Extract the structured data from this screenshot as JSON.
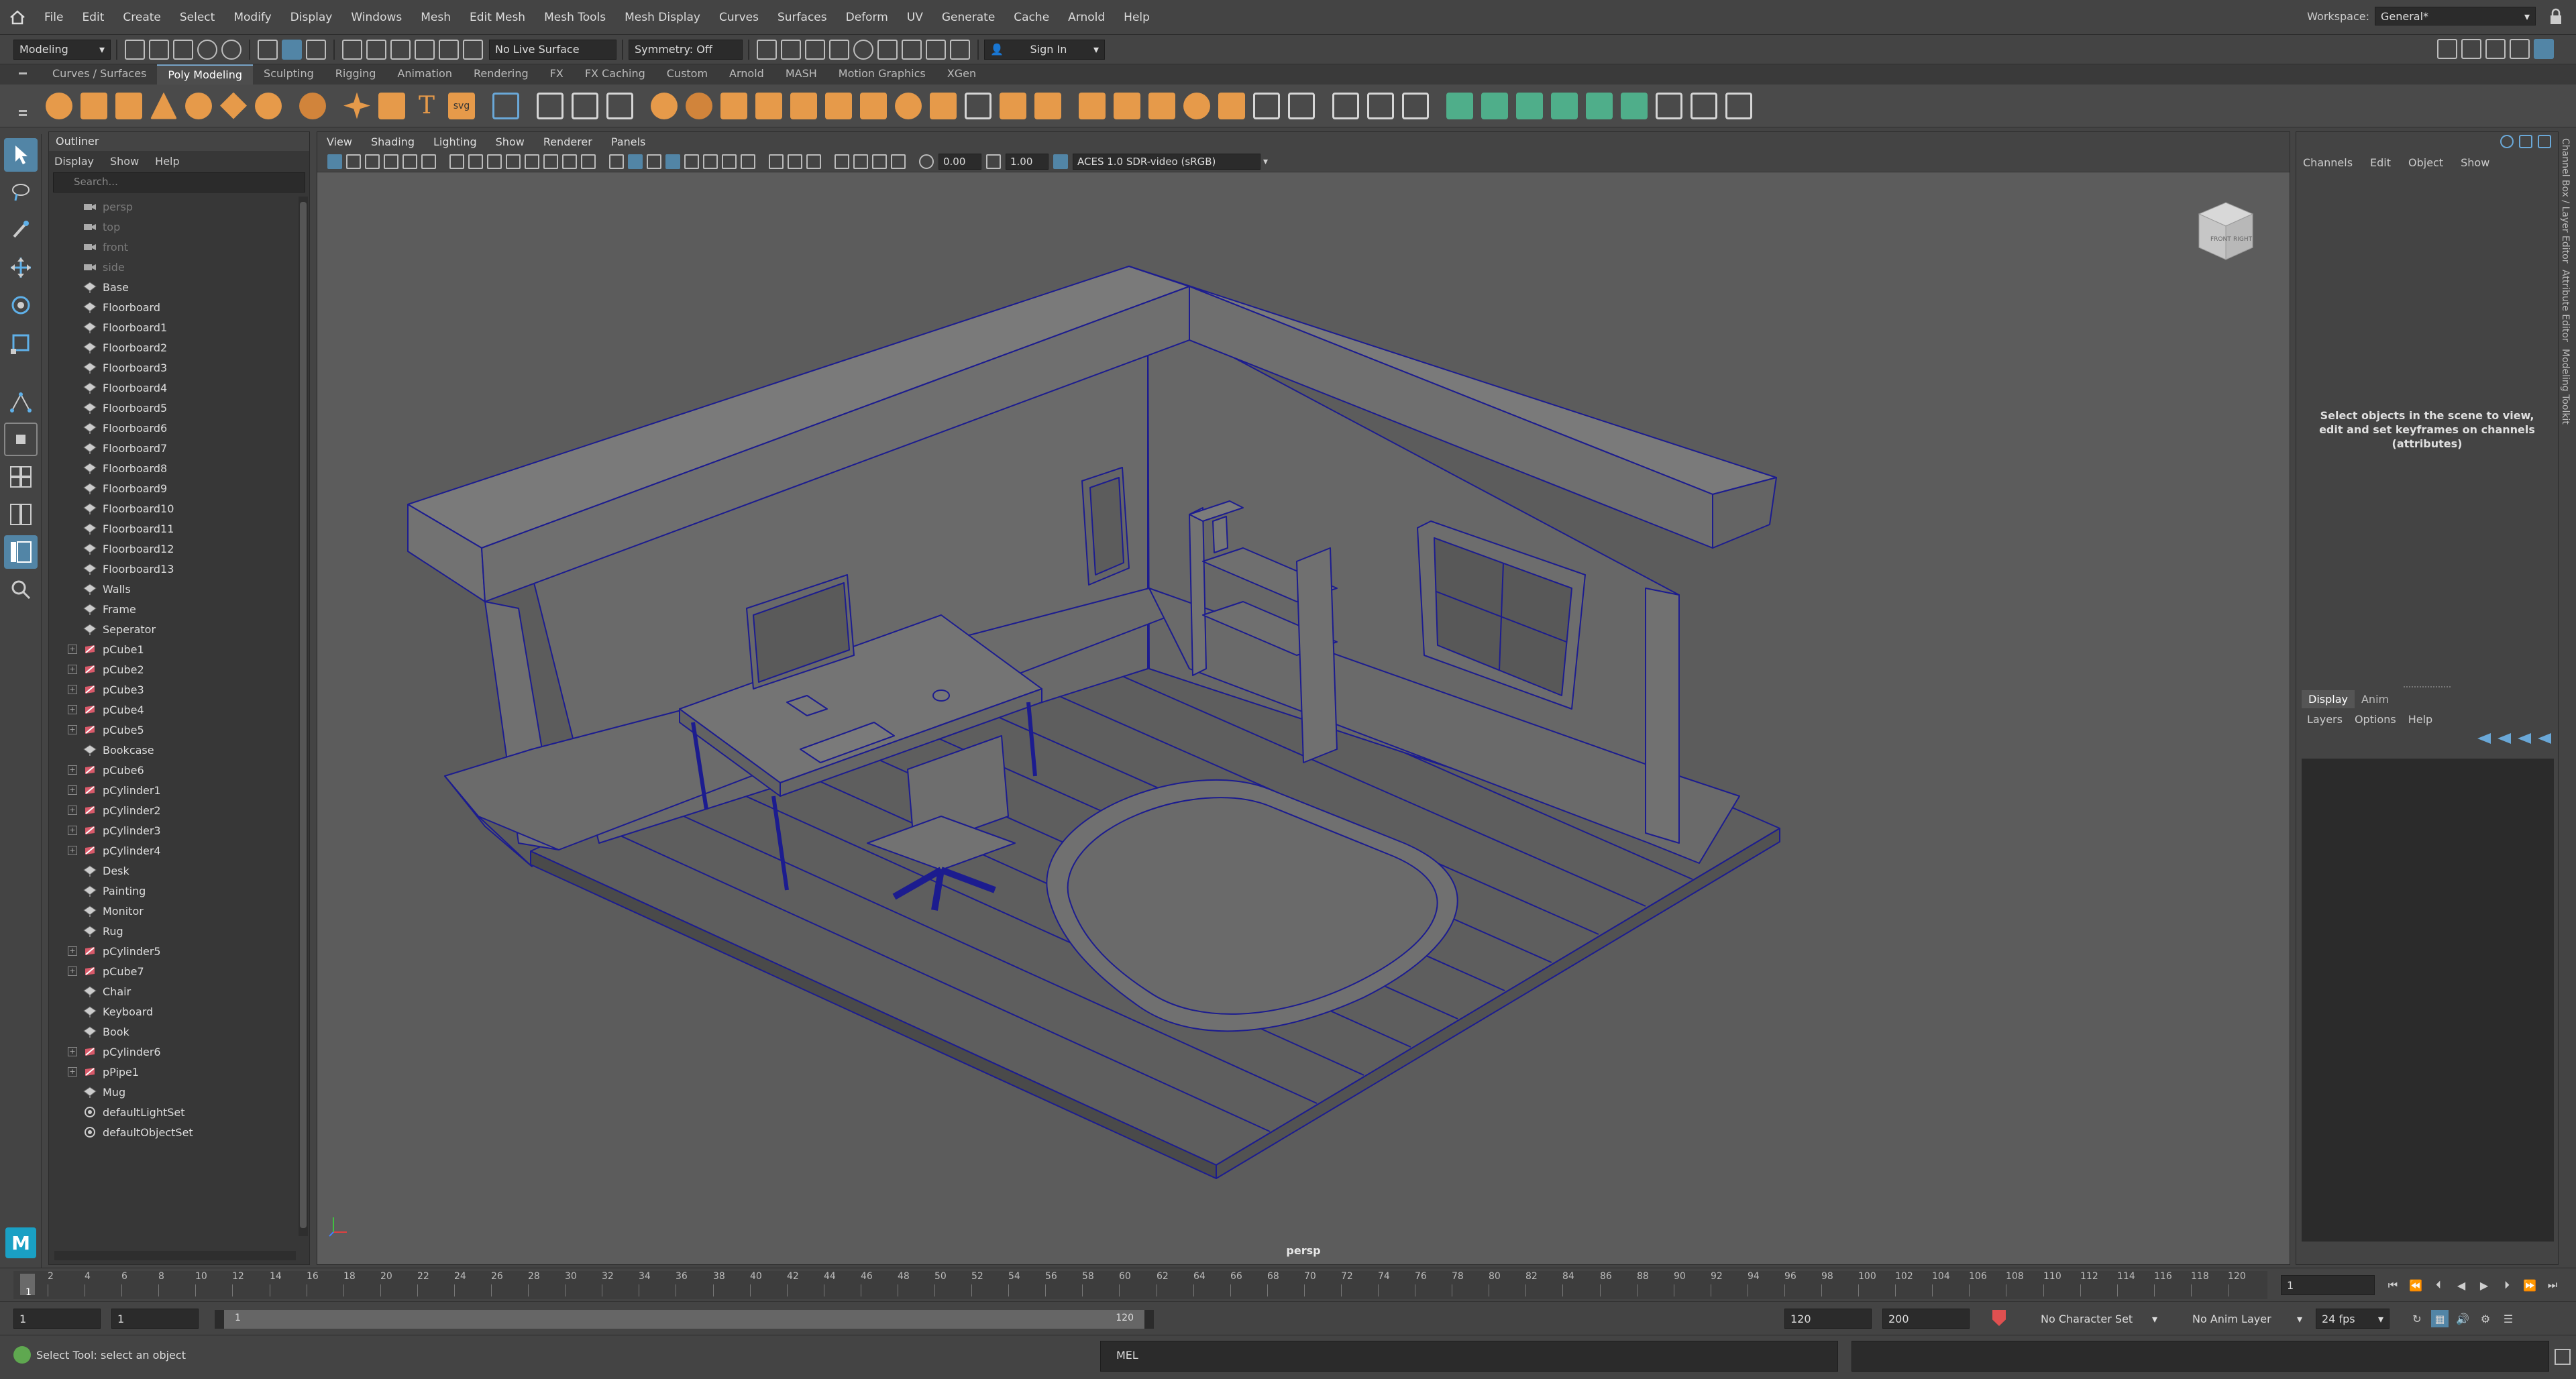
{
  "menubar": {
    "items": [
      "File",
      "Edit",
      "Create",
      "Select",
      "Modify",
      "Display",
      "Windows",
      "Mesh",
      "Edit Mesh",
      "Mesh Tools",
      "Mesh Display",
      "Curves",
      "Surfaces",
      "Deform",
      "UV",
      "Generate",
      "Cache",
      "Arnold",
      "Help"
    ],
    "workspace_label": "Workspace:",
    "workspace_value": "General*"
  },
  "statusline": {
    "mode": "Modeling",
    "live_surface": "No Live Surface",
    "symmetry": "Symmetry: Off",
    "sign_in": "Sign In"
  },
  "shelf": {
    "tabs": [
      "Curves / Surfaces",
      "Poly Modeling",
      "Sculpting",
      "Rigging",
      "Animation",
      "Rendering",
      "FX",
      "FX Caching",
      "Custom",
      "Arnold",
      "MASH",
      "Motion Graphics",
      "XGen"
    ],
    "active_tab": "Poly Modeling",
    "text_tool_label": "T",
    "svg_label": "svg"
  },
  "outliner": {
    "title": "Outliner",
    "menu": [
      "Display",
      "Show",
      "Help"
    ],
    "search_placeholder": "Search...",
    "items": [
      {
        "label": "persp",
        "kind": "camera",
        "expand": false
      },
      {
        "label": "top",
        "kind": "camera",
        "expand": false
      },
      {
        "label": "front",
        "kind": "camera",
        "expand": false
      },
      {
        "label": "side",
        "kind": "camera",
        "expand": false
      },
      {
        "label": "Base",
        "kind": "mesh",
        "expand": false
      },
      {
        "label": "Floorboard",
        "kind": "mesh",
        "expand": false
      },
      {
        "label": "Floorboard1",
        "kind": "mesh",
        "expand": false
      },
      {
        "label": "Floorboard2",
        "kind": "mesh",
        "expand": false
      },
      {
        "label": "Floorboard3",
        "kind": "mesh",
        "expand": false
      },
      {
        "label": "Floorboard4",
        "kind": "mesh",
        "expand": false
      },
      {
        "label": "Floorboard5",
        "kind": "mesh",
        "expand": false
      },
      {
        "label": "Floorboard6",
        "kind": "mesh",
        "expand": false
      },
      {
        "label": "Floorboard7",
        "kind": "mesh",
        "expand": false
      },
      {
        "label": "Floorboard8",
        "kind": "mesh",
        "expand": false
      },
      {
        "label": "Floorboard9",
        "kind": "mesh",
        "expand": false
      },
      {
        "label": "Floorboard10",
        "kind": "mesh",
        "expand": false
      },
      {
        "label": "Floorboard11",
        "kind": "mesh",
        "expand": false
      },
      {
        "label": "Floorboard12",
        "kind": "mesh",
        "expand": false
      },
      {
        "label": "Floorboard13",
        "kind": "mesh",
        "expand": false
      },
      {
        "label": "Walls",
        "kind": "mesh",
        "expand": false
      },
      {
        "label": "Frame",
        "kind": "mesh",
        "expand": false
      },
      {
        "label": "Seperator",
        "kind": "mesh",
        "expand": false
      },
      {
        "label": "pCube1",
        "kind": "history",
        "expand": true
      },
      {
        "label": "pCube2",
        "kind": "history",
        "expand": true
      },
      {
        "label": "pCube3",
        "kind": "history",
        "expand": true
      },
      {
        "label": "pCube4",
        "kind": "history",
        "expand": true
      },
      {
        "label": "pCube5",
        "kind": "history",
        "expand": true
      },
      {
        "label": "Bookcase",
        "kind": "mesh",
        "expand": false
      },
      {
        "label": "pCube6",
        "kind": "history",
        "expand": true
      },
      {
        "label": "pCylinder1",
        "kind": "history",
        "expand": true
      },
      {
        "label": "pCylinder2",
        "kind": "history",
        "expand": true
      },
      {
        "label": "pCylinder3",
        "kind": "history",
        "expand": true
      },
      {
        "label": "pCylinder4",
        "kind": "history",
        "expand": true
      },
      {
        "label": "Desk",
        "kind": "mesh",
        "expand": false
      },
      {
        "label": "Painting",
        "kind": "mesh",
        "expand": false
      },
      {
        "label": "Monitor",
        "kind": "mesh",
        "expand": false
      },
      {
        "label": "Rug",
        "kind": "mesh",
        "expand": false
      },
      {
        "label": "pCylinder5",
        "kind": "history",
        "expand": true
      },
      {
        "label": "pCube7",
        "kind": "history",
        "expand": true
      },
      {
        "label": "Chair",
        "kind": "mesh",
        "expand": false
      },
      {
        "label": "Keyboard",
        "kind": "mesh",
        "expand": false
      },
      {
        "label": "Book",
        "kind": "mesh",
        "expand": false
      },
      {
        "label": "pCylinder6",
        "kind": "history",
        "expand": true
      },
      {
        "label": "pPipe1",
        "kind": "history",
        "expand": true
      },
      {
        "label": "Mug",
        "kind": "mesh",
        "expand": false
      },
      {
        "label": "defaultLightSet",
        "kind": "set",
        "expand": false
      },
      {
        "label": "defaultObjectSet",
        "kind": "set",
        "expand": false
      }
    ]
  },
  "viewport": {
    "menu": [
      "View",
      "Shading",
      "Lighting",
      "Show",
      "Renderer",
      "Panels"
    ],
    "exposure": "0.00",
    "gamma": "1.00",
    "color_space": "ACES 1.0 SDR-video (sRGB)",
    "camera_label": "persp",
    "viewcube_front": "FRONT",
    "viewcube_right": "RIGHT"
  },
  "channelbox": {
    "menu": [
      "Channels",
      "Edit",
      "Object",
      "Show"
    ],
    "hint": "Select objects in the scene to view, edit and set keyframes on channels (attributes)",
    "layer_tabs": [
      "Display",
      "Anim"
    ],
    "layer_menu": [
      "Layers",
      "Options",
      "Help"
    ],
    "side_tabs": [
      "Channel Box / Layer Editor",
      "Attribute Editor",
      "Modeling Toolkit"
    ]
  },
  "timeslider": {
    "ticks": [
      "2",
      "4",
      "6",
      "8",
      "10",
      "12",
      "14",
      "16",
      "18",
      "20",
      "22",
      "24",
      "26",
      "28",
      "30",
      "32",
      "34",
      "36",
      "38",
      "40",
      "42",
      "44",
      "46",
      "48",
      "50",
      "52",
      "54",
      "56",
      "58",
      "60",
      "62",
      "64",
      "66",
      "68",
      "70",
      "72",
      "74",
      "76",
      "78",
      "80",
      "82",
      "84",
      "86",
      "88",
      "90",
      "92",
      "94",
      "96",
      "98",
      "100",
      "102",
      "104",
      "106",
      "108",
      "110",
      "112",
      "114",
      "116",
      "118",
      "120"
    ],
    "current_frame": "1",
    "current_frame_marker": "1"
  },
  "rangeslider": {
    "start": "1",
    "start_inner": "1",
    "bar_start": "1",
    "bar_end": "120",
    "end_inner": "120",
    "end": "200",
    "character_set": "No Character Set",
    "anim_layer": "No Anim Layer",
    "fps": "24 fps"
  },
  "cmdline": {
    "help": "Select Tool: select an object",
    "mel_label": "MEL"
  },
  "colors": {
    "accent": "#5285a6",
    "shelf_orange": "#e69a4a",
    "shelf_green": "#4fae8a",
    "wire": "#1c1c8f"
  }
}
